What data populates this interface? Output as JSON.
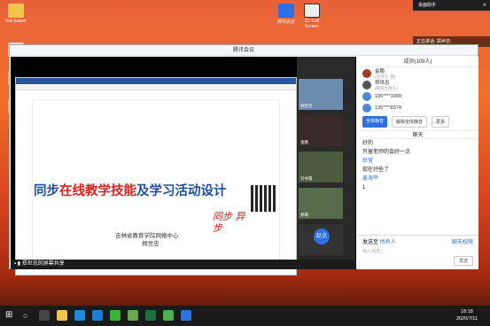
{
  "desktop": {
    "icons_left": [
      {
        "label": "han jasper"
      },
      {
        "label": ""
      },
      {
        "label": ""
      },
      {
        "label": ""
      },
      {
        "label": ""
      }
    ],
    "icons_top": [
      {
        "label": "腾讯会议"
      },
      {
        "label": "2D Soft Screen"
      }
    ]
  },
  "notification": {
    "title": "桌面助手"
  },
  "speaker_tag": {
    "text": "正在讲话: 郑世忠;"
  },
  "window": {
    "title": "腾讯会议",
    "slide": {
      "title_part1": "同步",
      "title_part2": "在线教学技能",
      "title_part3": "及学习活动设计",
      "org": "吉林省教育学院网络中心",
      "author": "郑世忠",
      "handwriting": "同步 异步"
    },
    "share_bar": "郑世忠的屏幕共享",
    "video_tiles": [
      {
        "label": "郑世忠"
      },
      {
        "label": "金鹏"
      },
      {
        "label": "刘书霞"
      },
      {
        "label": "郑萌"
      },
      {
        "label": "赵点"
      }
    ]
  },
  "members": {
    "title": "成员(109人)",
    "rows": [
      {
        "name": "金鹏",
        "sub": "(主持人, 我)"
      },
      {
        "name": "郑世忠",
        "sub": "(联席主持人)"
      },
      {
        "name": "136****1009",
        "sub": ""
      },
      {
        "name": "136****8374",
        "sub": ""
      }
    ],
    "mute_all": "全体静音",
    "unmute_all": "解除全体静音",
    "more": "更多"
  },
  "chat": {
    "title": "聊天",
    "messages": [
      {
        "name": "",
        "text": "好的"
      },
      {
        "name": "",
        "text": "只留老师的会好一点"
      },
      {
        "name": "岳莹",
        "text": "现在好些了"
      },
      {
        "name": "姜海平",
        "text": "1"
      }
    ],
    "send_to_label": "发送至",
    "send_to_value": "所有人",
    "permission": "聊天权限",
    "input_placeholder": "输入消息...",
    "send_button": "发送"
  },
  "taskbar": {
    "time": "18:18",
    "date": "2020/7/11"
  }
}
